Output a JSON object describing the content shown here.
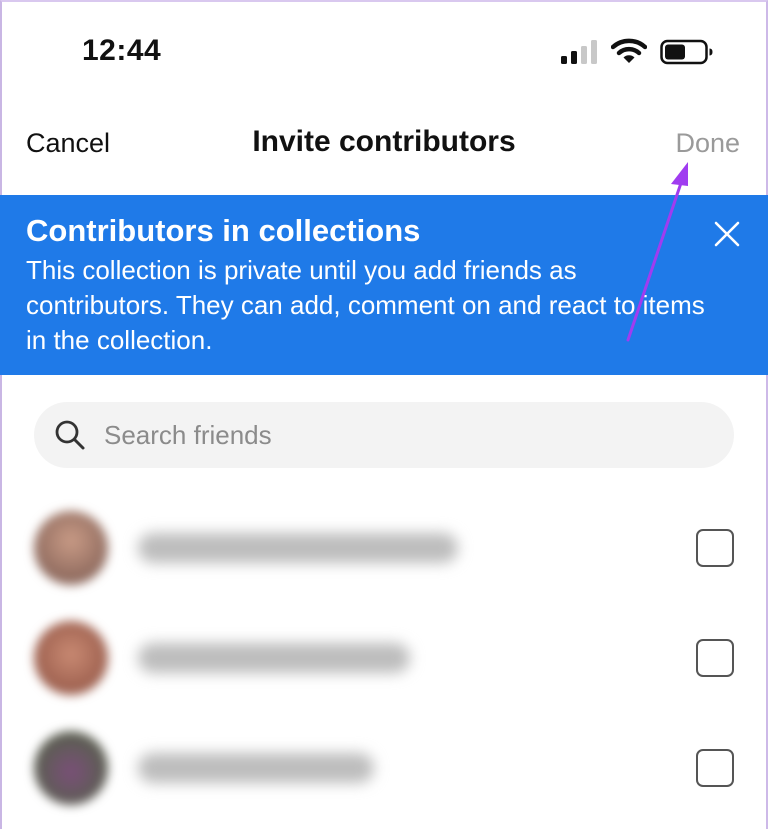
{
  "status_bar": {
    "time": "12:44"
  },
  "nav": {
    "cancel_label": "Cancel",
    "title": "Invite contributors",
    "done_label": "Done"
  },
  "banner": {
    "title": "Contributors in collections",
    "body": "This collection is private until you add friends as contributors. They can add, comment on and react to items in the collection.",
    "color": "#1f7ae8"
  },
  "search": {
    "placeholder": "Search friends",
    "value": ""
  },
  "friends": [
    {
      "checked": false
    },
    {
      "checked": false
    },
    {
      "checked": false
    }
  ],
  "colors": {
    "accent": "#1f7ae8",
    "annotation_arrow": "#a03cf0",
    "done_disabled": "#9a9a9a"
  }
}
